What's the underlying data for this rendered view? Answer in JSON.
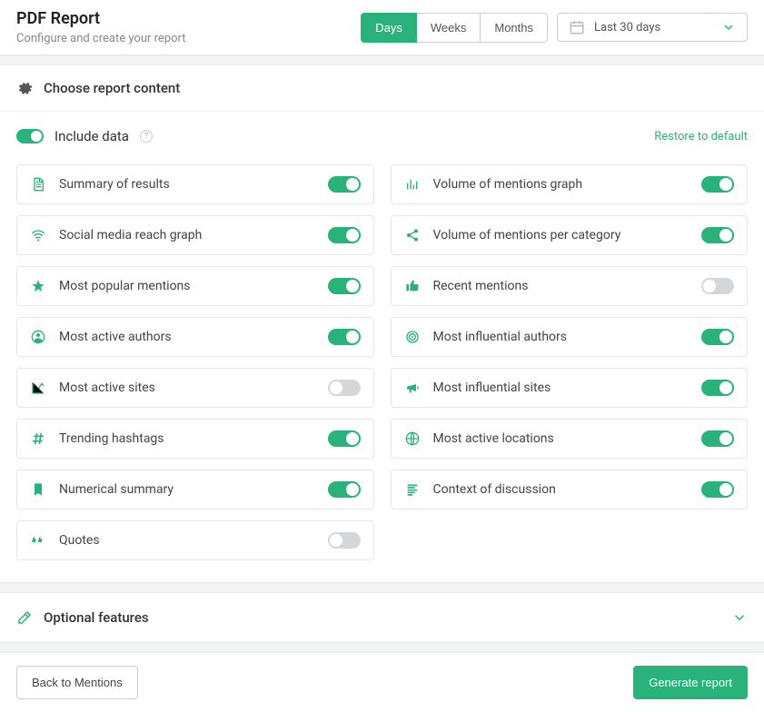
{
  "header": {
    "title": "PDF Report",
    "subtitle": "Configure and create your report",
    "period_tabs": {
      "days": "Days",
      "weeks": "Weeks",
      "months": "Months"
    },
    "date_range": "Last 30 days"
  },
  "section": {
    "title": "Choose report content",
    "include_label": "Include data",
    "restore": "Restore to default",
    "items": [
      {
        "label": "Summary of results",
        "icon": "file",
        "on": true
      },
      {
        "label": "Volume of mentions graph",
        "icon": "bar-chart",
        "on": true
      },
      {
        "label": "Social media reach graph",
        "icon": "wifi",
        "on": true
      },
      {
        "label": "Volume of mentions per category",
        "icon": "share",
        "on": true
      },
      {
        "label": "Most popular mentions",
        "icon": "star",
        "on": true
      },
      {
        "label": "Recent mentions",
        "icon": "thumb-up",
        "on": false
      },
      {
        "label": "Most active authors",
        "icon": "user-circle",
        "on": true
      },
      {
        "label": "Most influential authors",
        "icon": "target",
        "on": true
      },
      {
        "label": "Most active sites",
        "icon": "line-chart",
        "on": false
      },
      {
        "label": "Most influential sites",
        "icon": "megaphone",
        "on": true
      },
      {
        "label": "Trending hashtags",
        "icon": "hash",
        "on": true
      },
      {
        "label": "Most active locations",
        "icon": "globe",
        "on": true
      },
      {
        "label": "Numerical summary",
        "icon": "bookmark",
        "on": true
      },
      {
        "label": "Context of discussion",
        "icon": "align",
        "on": true
      },
      {
        "label": "Quotes",
        "icon": "quote",
        "on": false
      }
    ]
  },
  "optional": {
    "title": "Optional features"
  },
  "footer": {
    "back": "Back to Mentions",
    "generate": "Generate report"
  }
}
